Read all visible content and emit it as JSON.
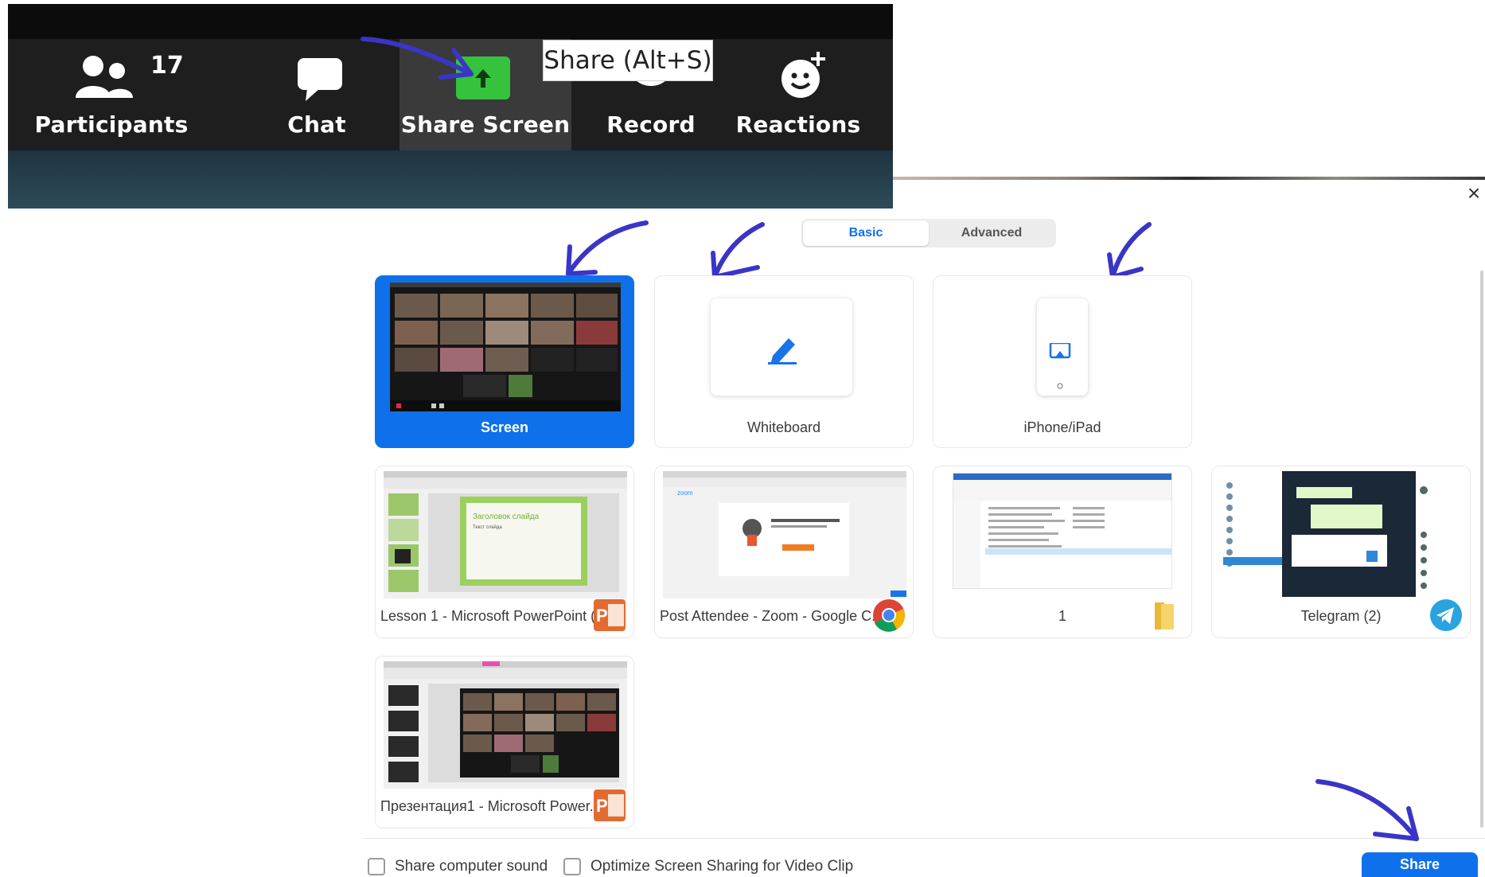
{
  "toolbar": {
    "participants": {
      "label": "Participants",
      "count": "17",
      "icon": "participants-icon"
    },
    "chat": {
      "label": "Chat",
      "icon": "chat-bubble-icon"
    },
    "share_screen": {
      "label": "Share Screen",
      "icon": "share-screen-arrow-icon",
      "accent": "#35c23d"
    },
    "record": {
      "label": "Record",
      "icon": "record-icon"
    },
    "reactions": {
      "label": "Reactions",
      "icon": "emoji-plus-icon"
    },
    "tooltip": "Share (Alt+S)"
  },
  "dialog": {
    "tabs": [
      {
        "label": "Basic",
        "active": true
      },
      {
        "label": "Advanced",
        "active": false
      }
    ],
    "tiles": [
      {
        "label": "Screen",
        "kind": "screen",
        "selected": true
      },
      {
        "label": "Whiteboard",
        "kind": "whiteboard",
        "icon": "pen-icon"
      },
      {
        "label": "iPhone/iPad",
        "kind": "iphone",
        "icon": "airplay-phone-icon"
      },
      {
        "label": "Lesson 1 - Microsoft PowerPoint (...",
        "kind": "window",
        "app": "powerpoint-icon"
      },
      {
        "label": "Post Attendee - Zoom - Google C...",
        "kind": "window",
        "app": "chrome-icon"
      },
      {
        "label": "1",
        "kind": "window",
        "app": "folder-icon"
      },
      {
        "label": "Telegram (2)",
        "kind": "window",
        "app": "telegram-icon"
      },
      {
        "label": "Презентация1 - Microsoft Power...",
        "kind": "window",
        "app": "powerpoint-icon"
      }
    ],
    "thumb_texts": {
      "slide_title": "Заголовок слайда",
      "slide_text": "Текст слайда",
      "zoom_logo": "zoom"
    },
    "options": [
      {
        "label": "Share computer sound",
        "checked": false
      },
      {
        "label": "Optimize Screen Sharing for Video Clip",
        "checked": false
      }
    ],
    "share_button": "Share",
    "close": "×",
    "accent": "#0e71eb"
  }
}
